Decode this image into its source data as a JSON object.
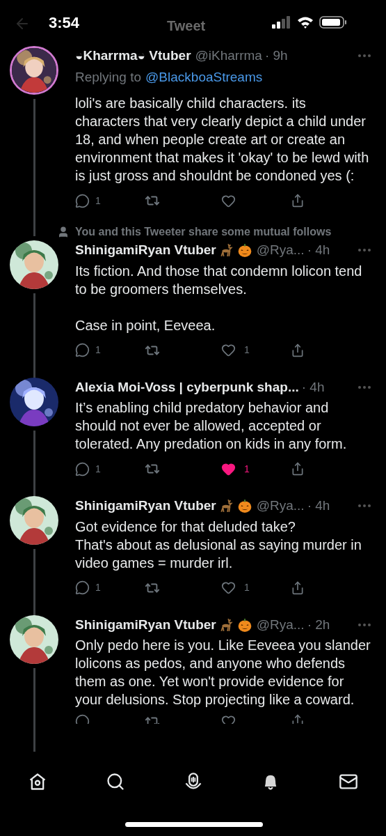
{
  "status_bar": {
    "time": "3:54"
  },
  "header": {
    "title": "Tweet"
  },
  "tweets": [
    {
      "avatar_ring": true,
      "name": "◒Kharrma◒ Vtuber",
      "handle": "@iKharrma",
      "time": "· 9h",
      "replying_to_label": "Replying to",
      "replying_to": "@BlackboaStreams",
      "text": "loli's are basically child characters. its characters that very clearly depict a child under 18, and when people create art or create an environment that makes it 'okay' to be lewd with is just gross and shouldnt be condoned yes (:",
      "actions": {
        "replies": "1",
        "liked": false,
        "cut": false
      }
    },
    {
      "avatar_ring": false,
      "mutual_note": "You and this Tweeter share some mutual follows",
      "name": "ShinigamiRyan Vtuber",
      "badges": [
        {
          "kind": "deer"
        },
        {
          "kind": "pumpkin"
        }
      ],
      "handle": "@Rya...",
      "time": "· 4h",
      "text": "Its fiction. And those that condemn lolicon tend to be groomers themselves.\n\nCase in point, Eeveea.",
      "actions": {
        "replies": "1",
        "likes": "1",
        "liked": false,
        "cut": false
      }
    },
    {
      "avatar_ring": false,
      "name": "Alexia Moi-Voss | cyberpunk shap...",
      "time": "· 4h",
      "text": "It’s enabling child predatory behavior and should not ever be allowed, accepted or tolerated. Any predation on kids in any form.",
      "actions": {
        "replies": "1",
        "likes": "1",
        "liked": true,
        "cut": false
      }
    },
    {
      "avatar_ring": false,
      "name": "ShinigamiRyan Vtuber",
      "badges": [
        {
          "kind": "deer"
        },
        {
          "kind": "pumpkin"
        }
      ],
      "handle": "@Rya...",
      "time": "· 4h",
      "text": "Got evidence for that deluded take?\nThat's about as delusional as saying murder in video games = murder irl.",
      "actions": {
        "replies": "1",
        "likes": "1",
        "liked": false,
        "cut": false
      }
    },
    {
      "avatar_ring": false,
      "name": "ShinigamiRyan Vtuber",
      "badges": [
        {
          "kind": "deer"
        },
        {
          "kind": "pumpkin"
        }
      ],
      "handle": "@Rya...",
      "time": "· 2h",
      "text": "Only pedo here is you. Like Eeveea you slander lolicons as pedos, and anyone who defends them as one. Yet won't provide evidence for your delusions. Stop projecting like a coward.",
      "actions": {
        "liked": false,
        "cut": true
      }
    }
  ],
  "tab_bar": [
    {
      "kind": "home",
      "selected": true
    },
    {
      "kind": "search",
      "selected": false
    },
    {
      "kind": "spaces",
      "selected": false
    },
    {
      "kind": "notifications",
      "selected": false
    },
    {
      "kind": "messages",
      "selected": false
    }
  ]
}
